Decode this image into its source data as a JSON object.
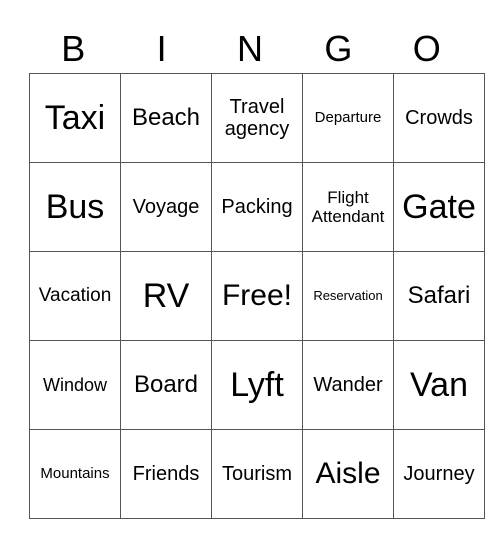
{
  "header": [
    "B",
    "I",
    "N",
    "G",
    "O"
  ],
  "rows": [
    [
      "Taxi",
      "Beach",
      "Travel agency",
      "Departure",
      "Crowds"
    ],
    [
      "Bus",
      "Voyage",
      "Packing",
      "Flight Attendant",
      "Gate"
    ],
    [
      "Vacation",
      "RV",
      "Free!",
      "Reservation",
      "Safari"
    ],
    [
      "Window",
      "Board",
      "Lyft",
      "Wander",
      "Van"
    ],
    [
      "Mountains",
      "Friends",
      "Tourism",
      "Aisle",
      "Journey"
    ]
  ]
}
